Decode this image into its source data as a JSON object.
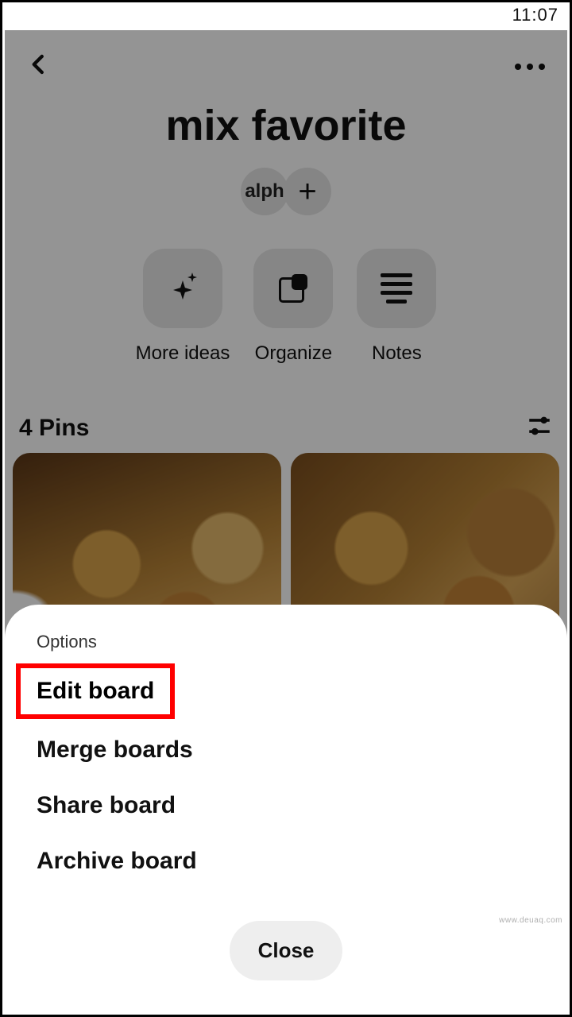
{
  "statusbar": {
    "time": "11:07"
  },
  "header": {
    "title": "mix favorite",
    "collaborator_label": "alph"
  },
  "actions": {
    "more_ideas": "More ideas",
    "organize": "Organize",
    "notes": "Notes"
  },
  "pins": {
    "count_label": "4 Pins"
  },
  "sheet": {
    "title": "Options",
    "edit": "Edit board",
    "merge": "Merge boards",
    "share": "Share board",
    "archive": "Archive board",
    "close": "Close"
  },
  "watermark": "www.deuaq.com"
}
